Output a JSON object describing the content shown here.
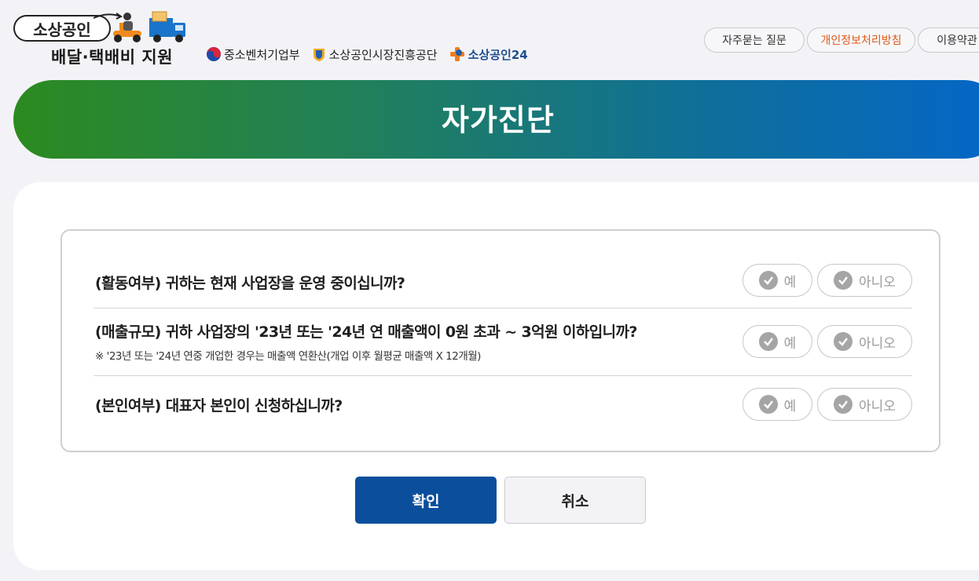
{
  "brand": {
    "title": "소상공인",
    "subtitle": "배달·택배비 지원"
  },
  "partners": [
    {
      "label": "중소벤처기업부",
      "icon": "taegeuk-icon"
    },
    {
      "label": "소상공인시장진흥공단",
      "icon": "semas-shield-icon"
    },
    {
      "label": "소상공인24",
      "icon": "plus-p-icon"
    }
  ],
  "top_links": [
    {
      "label": "자주묻는 질문"
    },
    {
      "label": "개인정보처리방침"
    },
    {
      "label": "이용약관"
    }
  ],
  "banner": {
    "title": "자가진단"
  },
  "questions": [
    {
      "text": "(활동여부) 귀하는 현재 사업장을 운영 중이십니까?",
      "note": "",
      "yes": "예",
      "no": "아니오"
    },
    {
      "text": "(매출규모) 귀하 사업장의 '23년 또는 '24년 연 매출액이 0원 초과 ~ 3억원 이하입니까?",
      "note": "※ '23년 또는 '24년 연중 개업한 경우는 매출액 연환산(개업 이후 월평균 매출액 X 12개월)",
      "yes": "예",
      "no": "아니오"
    },
    {
      "text": "(본인여부) 대표자 본인이 신청하십니까?",
      "note": "",
      "yes": "예",
      "no": "아니오"
    }
  ],
  "actions": {
    "confirm": "확인",
    "cancel": "취소"
  },
  "colors": {
    "primary": "#0b4f9c",
    "banner_start": "#2c8a20",
    "banner_end": "#0466c8",
    "privacy_link": "#e05a1b"
  }
}
